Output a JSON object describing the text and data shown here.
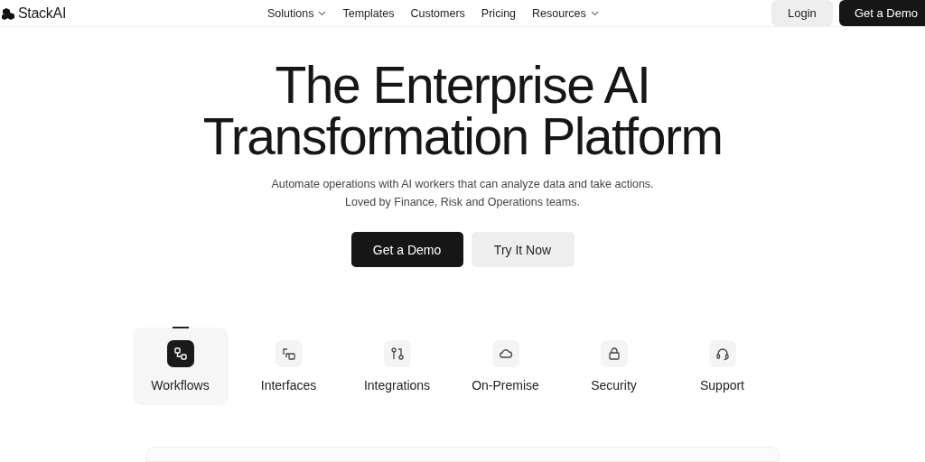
{
  "header": {
    "brand": "StackAI",
    "nav": [
      {
        "label": "Solutions",
        "dropdown": true
      },
      {
        "label": "Templates",
        "dropdown": false
      },
      {
        "label": "Customers",
        "dropdown": false
      },
      {
        "label": "Pricing",
        "dropdown": false
      },
      {
        "label": "Resources",
        "dropdown": true
      }
    ],
    "login": "Login",
    "demo": "Get a Demo"
  },
  "hero": {
    "title_lines": [
      "The Enterprise AI",
      "Transformation Platform"
    ],
    "subtitle_lines": [
      "Automate operations with AI workers that can analyze data and take actions.",
      "Loved by Finance, Risk and Operations teams."
    ],
    "primary_button": "Get a Demo",
    "secondary_button": "Try It Now"
  },
  "tabs": [
    {
      "label": "Workflows",
      "kind": "workflow",
      "selected": true
    },
    {
      "label": "Interfaces",
      "kind": "interface",
      "selected": false
    },
    {
      "label": "Integrations",
      "kind": "integration",
      "selected": false
    },
    {
      "label": "On-Premise",
      "kind": "cloud",
      "selected": false
    },
    {
      "label": "Security",
      "kind": "lock",
      "selected": false
    },
    {
      "label": "Support",
      "kind": "headset",
      "selected": false
    }
  ]
}
